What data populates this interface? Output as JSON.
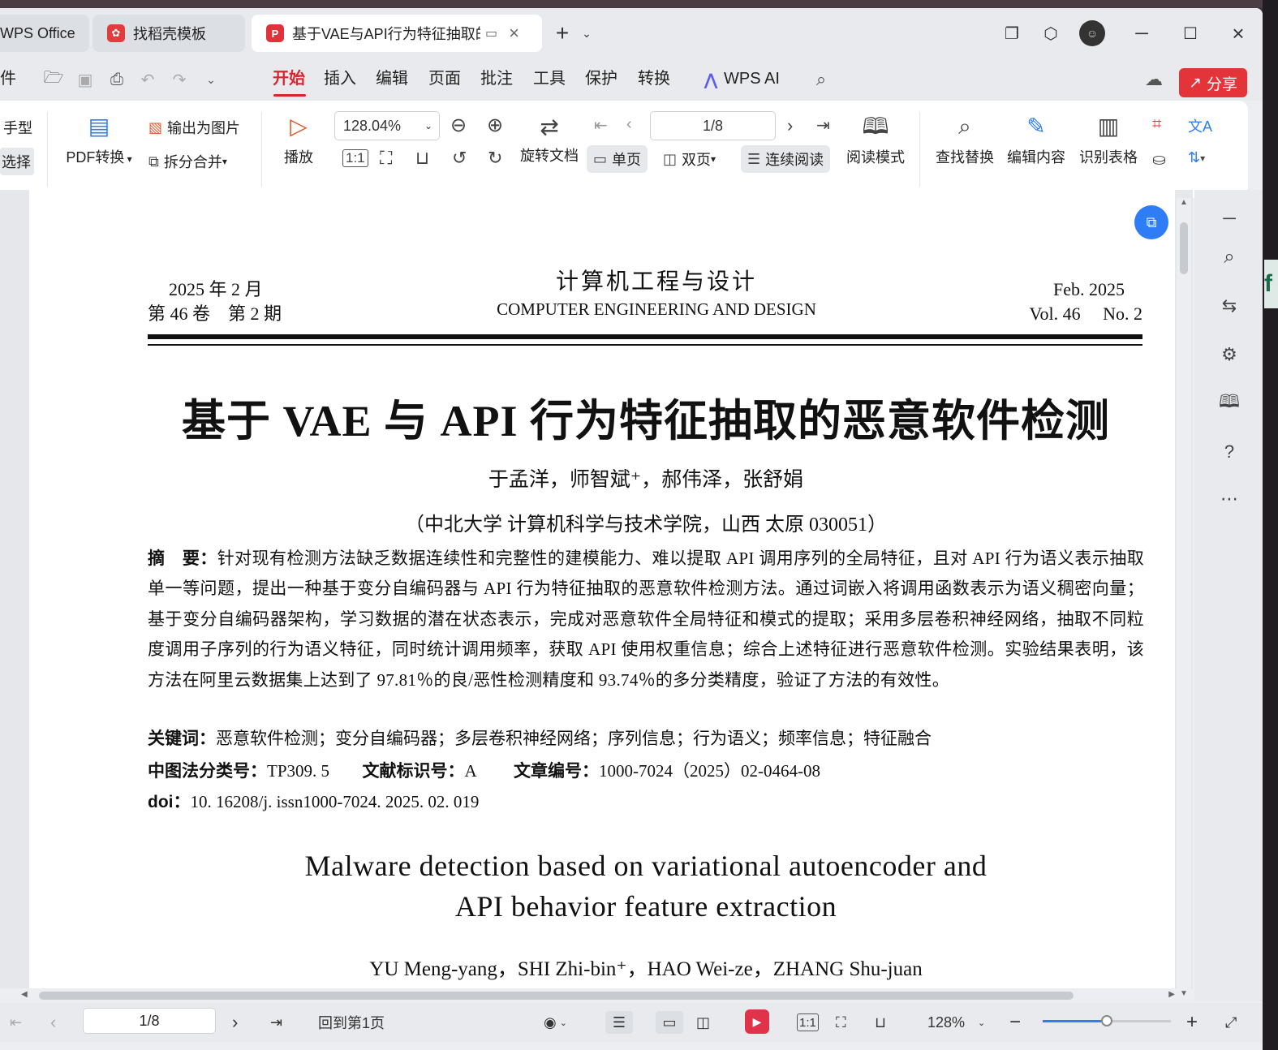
{
  "tabs": [
    {
      "label": "WPS Office",
      "active": false
    },
    {
      "label": "找稻壳模板",
      "active": false
    },
    {
      "label": "基于VAE与API行为特征抽取的",
      "active": true
    }
  ],
  "menu": {
    "file_label": "件",
    "items": [
      "开始",
      "插入",
      "编辑",
      "页面",
      "批注",
      "工具",
      "保护",
      "转换"
    ],
    "active": "开始",
    "ai_label": "WPS AI",
    "share_label": "分享"
  },
  "ribbon": {
    "hand_tool": "手型",
    "select_tool": "选择",
    "pdf_convert": "PDF转换",
    "export_image": "输出为图片",
    "split_merge": "拆分合并",
    "play": "播放",
    "zoom_value": "128.04%",
    "rotate_doc": "旋转文档",
    "page_value": "1/8",
    "single_page": "单页",
    "double_page": "双页",
    "continuous": "连续阅读",
    "read_mode": "阅读模式",
    "find_replace": "查找替换",
    "edit_content": "编辑内容",
    "recognize_table": "识别表格"
  },
  "document": {
    "header_left_1": "2025 年 2 月",
    "header_left_2": "第 46 卷　第 2 期",
    "journal_cn": "计算机工程与设计",
    "journal_en": "COMPUTER ENGINEERING AND DESIGN",
    "header_right_1": "Feb.  2025",
    "header_right_2": "Vol. 46　 No. 2",
    "title": "基于 VAE 与 API 行为特征抽取的恶意软件检测",
    "authors": "于孟洋，师智斌⁺，郝伟泽，张舒娟",
    "affiliation": "（中北大学 计算机科学与技术学院，山西 太原 030051）",
    "abstract_label": "摘　要：",
    "abstract_text": "针对现有检测方法缺乏数据连续性和完整性的建模能力、难以提取 API 调用序列的全局特征，且对 API 行为语义表示抽取单一等问题，提出一种基于变分自编码器与 API 行为特征抽取的恶意软件检测方法。通过词嵌入将调用函数表示为语义稠密向量；基于变分自编码器架构，学习数据的潜在状态表示，完成对恶意软件全局特征和模式的提取；采用多层卷积神经网络，抽取不同粒度调用子序列的行为语义特征，同时统计调用频率，获取 API 使用权重信息；综合上述特征进行恶意软件检测。实验结果表明，该方法在阿里云数据集上达到了 97.81％的良/恶性检测精度和 93.74％的多分类精度，验证了方法的有效性。",
    "keywords_label": "关键词：",
    "keywords_text": "恶意软件检测；变分自编码器；多层卷积神经网络；序列信息；行为语义；频率信息；特征融合",
    "clc_label": "中图法分类号：",
    "clc_value": "TP309. 5",
    "doccode_label": "文献标识号：",
    "doccode_value": "A",
    "article_label": "文章编号：",
    "article_value": "1000-7024（2025）02-0464-08",
    "doi_label": "doi：",
    "doi_value": "10. 16208/j. issn1000-7024. 2025. 02. 019",
    "en_title_1": "Malware detection based on variational autoencoder and",
    "en_title_2": "API behavior feature extraction",
    "en_authors": "YU Meng-yang，SHI Zhi-bin⁺，HAO Wei-ze，ZHANG Shu-juan"
  },
  "status": {
    "page_value": "1/8",
    "back_to_first": "回到第1页",
    "zoom_value": "128%",
    "zoom_fraction": 0.5
  },
  "colors": {
    "accent": "#d9262e",
    "brand_blue": "#2e7cf6"
  }
}
